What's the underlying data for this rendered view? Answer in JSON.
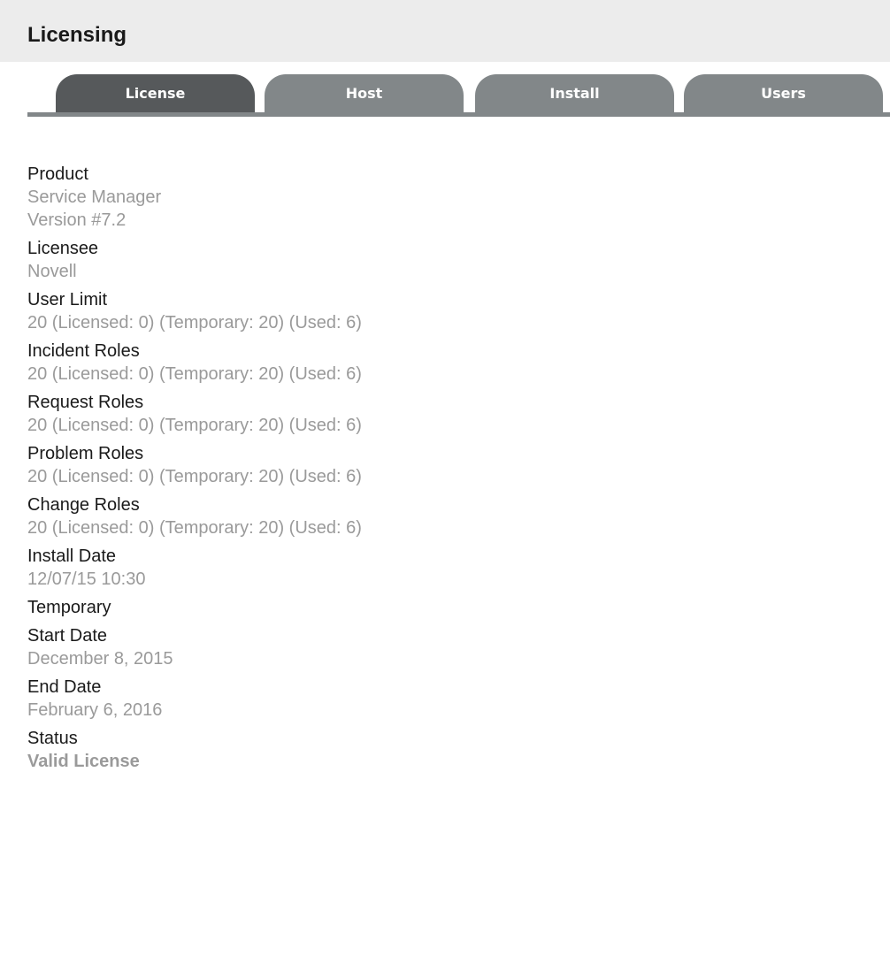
{
  "header": {
    "title": "Licensing"
  },
  "tabs": [
    {
      "label": "License",
      "active": true
    },
    {
      "label": "Host",
      "active": false
    },
    {
      "label": "Install",
      "active": false
    },
    {
      "label": "Users",
      "active": false
    }
  ],
  "fields": {
    "product": {
      "label": "Product",
      "value": "Service Manager",
      "value2": "Version #7.2"
    },
    "licensee": {
      "label": "Licensee",
      "value": "Novell"
    },
    "user_limit": {
      "label": "User Limit",
      "value": "20 (Licensed: 0) (Temporary: 20) (Used: 6)"
    },
    "incident_roles": {
      "label": "Incident Roles",
      "value": "20 (Licensed: 0) (Temporary: 20) (Used: 6)"
    },
    "request_roles": {
      "label": "Request Roles",
      "value": "20 (Licensed: 0) (Temporary: 20) (Used: 6)"
    },
    "problem_roles": {
      "label": "Problem Roles",
      "value": "20 (Licensed: 0) (Temporary: 20) (Used: 6)"
    },
    "change_roles": {
      "label": "Change Roles",
      "value": "20 (Licensed: 0) (Temporary: 20) (Used: 6)"
    },
    "install_date": {
      "label": "Install Date",
      "value": "12/07/15 10:30"
    },
    "temporary": {
      "label": "Temporary"
    },
    "start_date": {
      "label": "Start Date",
      "value": "December 8, 2015"
    },
    "end_date": {
      "label": "End Date",
      "value": "February 6, 2016"
    },
    "status": {
      "label": "Status",
      "value": "Valid License"
    }
  },
  "colors": {
    "header_bg": "#ececec",
    "tab_active": "#56595b",
    "tab_inactive": "#828789",
    "label_text": "#1a1a1a",
    "value_text": "#9a9a9a"
  }
}
